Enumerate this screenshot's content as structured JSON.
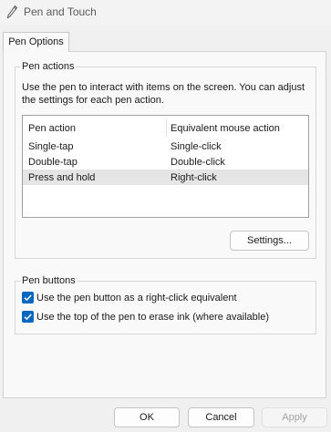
{
  "window": {
    "title": "Pen and Touch",
    "icon": "pen-icon"
  },
  "tabs": [
    {
      "label": "Pen Options",
      "selected": true
    }
  ],
  "pen_actions": {
    "legend": "Pen actions",
    "description_line1": "Use the pen to interact with items on the screen.  You can adjust",
    "description_line2": "the settings for each pen action.",
    "columns": [
      "Pen action",
      "Equivalent mouse action"
    ],
    "rows": [
      {
        "action": "Single-tap",
        "equivalent": "Single-click",
        "selected": false
      },
      {
        "action": "Double-tap",
        "equivalent": "Double-click",
        "selected": false
      },
      {
        "action": "Press and hold",
        "equivalent": "Right-click",
        "selected": true
      }
    ],
    "settings_button": "Settings..."
  },
  "pen_buttons": {
    "legend": "Pen buttons",
    "options": [
      {
        "label": "Use the pen button as a right-click equivalent",
        "checked": true
      },
      {
        "label": "Use the top of the pen to erase ink (where available)",
        "checked": true
      }
    ]
  },
  "footer": {
    "ok_label": "OK",
    "cancel_label": "Cancel",
    "apply_label": "Apply",
    "apply_enabled": false
  },
  "colors": {
    "accent": "#0067c0",
    "selected_row": "#e5e5e5"
  }
}
